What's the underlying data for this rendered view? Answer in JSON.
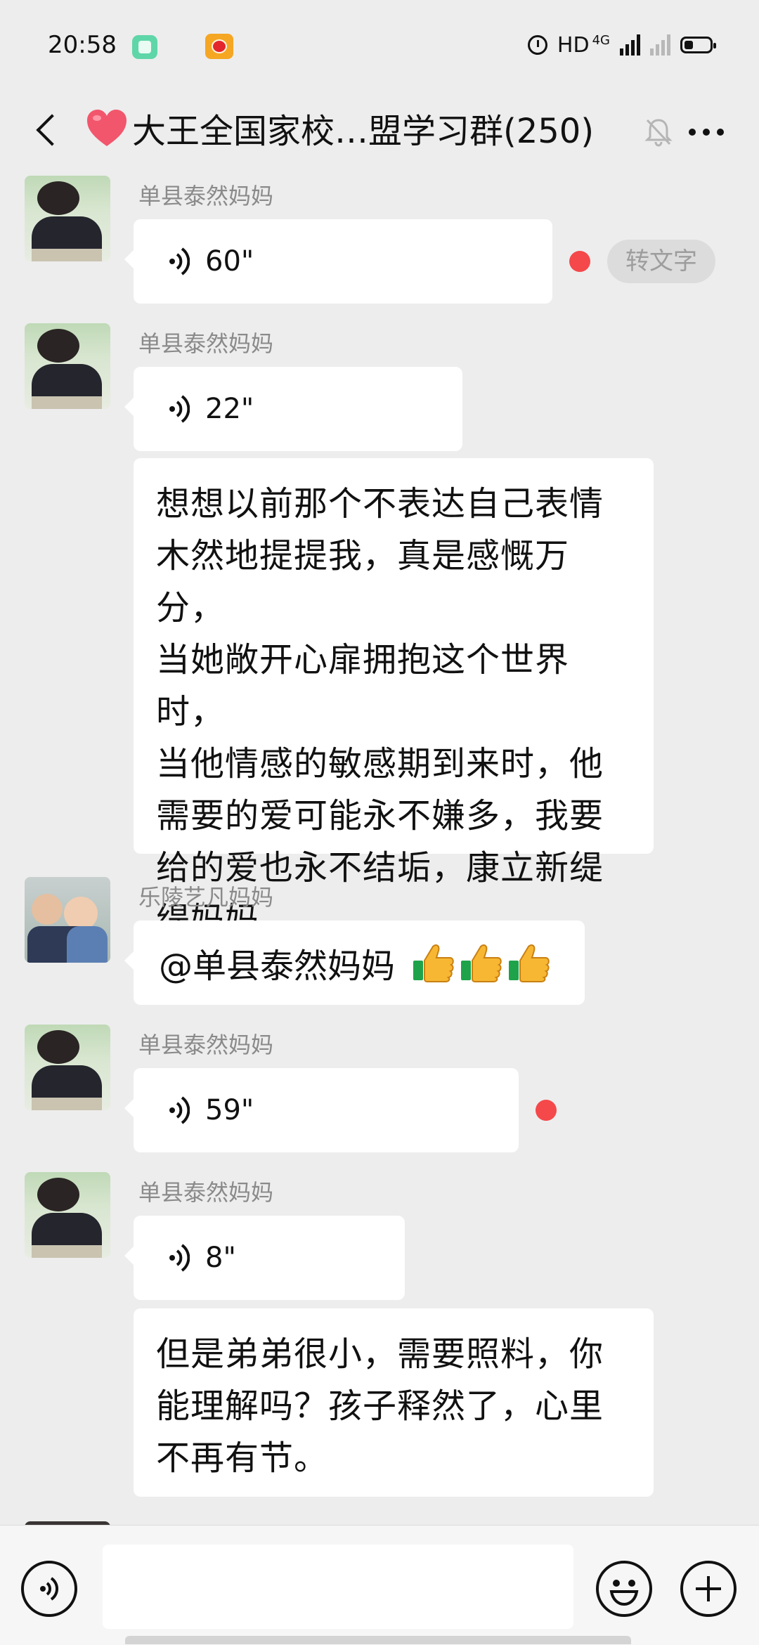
{
  "status_bar": {
    "time": "20:58",
    "network": "HD",
    "network_type": "4G",
    "icons": [
      "green-app-icon",
      "weibo-icon",
      "alarm-icon",
      "signal-icon",
      "battery-icon"
    ]
  },
  "header": {
    "title": "大王全国家校…盟学习群(250)",
    "heart_color": "#f2566c",
    "icons": [
      "back-icon",
      "heart-icon",
      "mute-bell-icon",
      "more-icon"
    ]
  },
  "messages": [
    {
      "type": "voice",
      "sender": "单县泰然妈妈",
      "duration": "60\"",
      "unread_dot": true,
      "convert_label": "转文字"
    },
    {
      "type": "voice",
      "sender": "单县泰然妈妈",
      "duration": "22\"",
      "unread_dot": false
    },
    {
      "type": "text",
      "text": "想想以前那个不表达自己表情\n木然地提提我，真是感慨万分，\n当她敞开心扉拥抱这个世界时，\n当他情感的敏感期到来时，他\n需要的爱可能永不嫌多，我要\n给的爱也永不结垢，康立新缇\n缇妈妈。"
    },
    {
      "type": "text",
      "sender": "乐陵艺凡妈妈",
      "text": "@单县泰然妈妈",
      "emoji": [
        "thumbs-up",
        "thumbs-up",
        "thumbs-up"
      ]
    },
    {
      "type": "voice",
      "sender": "单县泰然妈妈",
      "duration": "59\"",
      "unread_dot": true
    },
    {
      "type": "voice",
      "sender": "单县泰然妈妈",
      "duration": "8\"",
      "unread_dot": false
    },
    {
      "type": "text",
      "text": "但是弟弟很小，需要照料，你\n能理解吗？孩子释然了，心里\n不再有节。"
    }
  ],
  "colors": {
    "background": "#ededed",
    "bubble": "#ffffff",
    "unread_dot": "#f5484a",
    "name_text": "#8a8a8a"
  },
  "input_bar": {
    "icons": [
      "voice-input-icon",
      "emoji-icon",
      "plus-icon"
    ],
    "value": ""
  }
}
